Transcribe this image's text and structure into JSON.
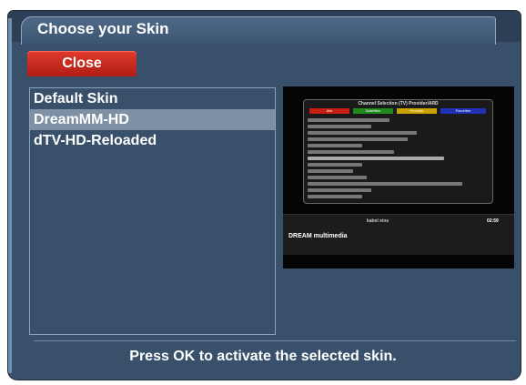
{
  "window": {
    "title": "Choose your Skin"
  },
  "buttons": {
    "close_label": "Close",
    "close_color": "#c8261b"
  },
  "skins": [
    {
      "label": "Default Skin",
      "selected": false
    },
    {
      "label": "DreamMM-HD",
      "selected": true
    },
    {
      "label": "dTV-HD-Reloaded",
      "selected": false
    }
  ],
  "preview": {
    "window_title": "Channel Selection (TV) Provider/ARD",
    "tabs": [
      "Alle",
      "Satelliten",
      "Provider",
      "Favoriten"
    ],
    "tab_colors": [
      "#c81d12",
      "#1e8a1e",
      "#c9a300",
      "#2031b8"
    ],
    "channel_name": "kabel eins",
    "logo": "DREAM multimedia",
    "clock": "02:59"
  },
  "footer": {
    "hint": "Press OK to activate the selected skin."
  },
  "colors": {
    "background": "#38506a",
    "selection": "#7e90a4",
    "accent": "#8aa3c0"
  }
}
